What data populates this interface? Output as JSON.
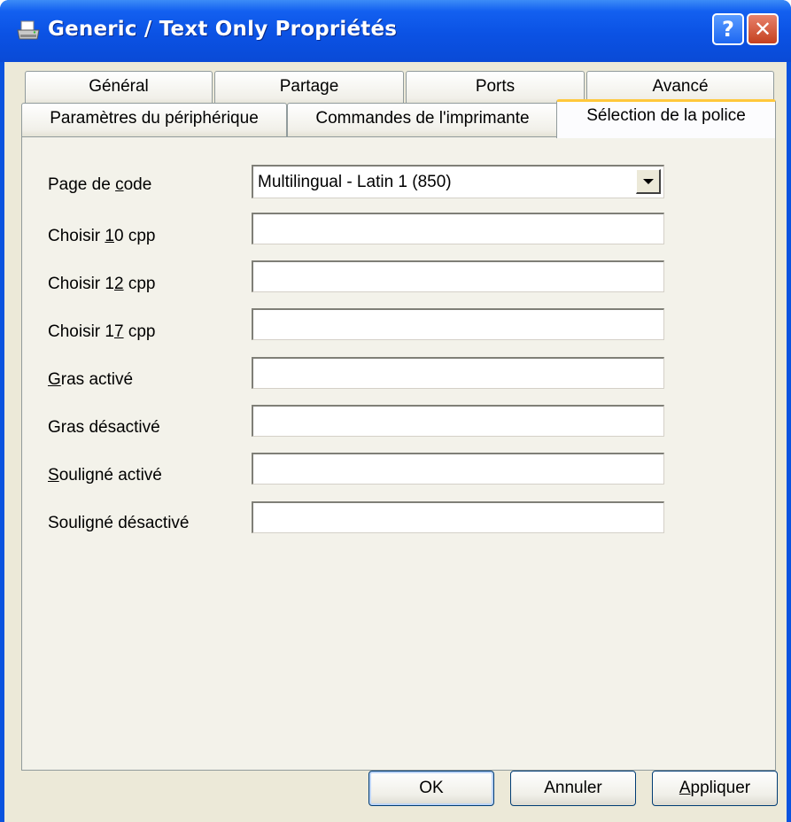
{
  "window": {
    "title": "Generic / Text Only Propriétés",
    "help_button": "?",
    "close_button": "✕"
  },
  "tabs_row_back": [
    {
      "label": "Général"
    },
    {
      "label": "Partage"
    },
    {
      "label": "Ports"
    },
    {
      "label": "Avancé"
    }
  ],
  "tabs_row_front": [
    {
      "label": "Paramètres du périphérique"
    },
    {
      "label": "Commandes de l'imprimante"
    },
    {
      "label": "Sélection de la police",
      "active": true
    }
  ],
  "form": {
    "code_page": {
      "label_before": "Page de ",
      "label_key": "c",
      "label_after": "ode",
      "value": "Multilingual - Latin 1 (850)"
    },
    "cpp10": {
      "label_before": "Choisir ",
      "label_key": "1",
      "label_after": "0 cpp",
      "value": ""
    },
    "cpp12": {
      "label_before": "Choisir 1",
      "label_key": "2",
      "label_after": " cpp",
      "value": ""
    },
    "cpp17": {
      "label_before": "Choisir 1",
      "label_key": "7",
      "label_after": " cpp",
      "value": ""
    },
    "bold_on": {
      "label_before": "",
      "label_key": "G",
      "label_after": "ras activé",
      "value": ""
    },
    "bold_off": {
      "label_before": "Gras désactivé",
      "label_key": "",
      "label_after": "",
      "value": ""
    },
    "underline_on": {
      "label_before": "",
      "label_key": "S",
      "label_after": "ouligné activé",
      "value": ""
    },
    "underline_off": {
      "label_before": "Souligné désactivé",
      "label_key": "",
      "label_after": "",
      "value": ""
    }
  },
  "buttons": {
    "ok": "OK",
    "cancel": "Annuler",
    "apply_key": "A",
    "apply_rest": "ppliquer"
  },
  "colors": {
    "titlebar": "#0b52e4",
    "dialog_face": "#ece9d8",
    "active_tab_accent": "#ffc83c"
  }
}
